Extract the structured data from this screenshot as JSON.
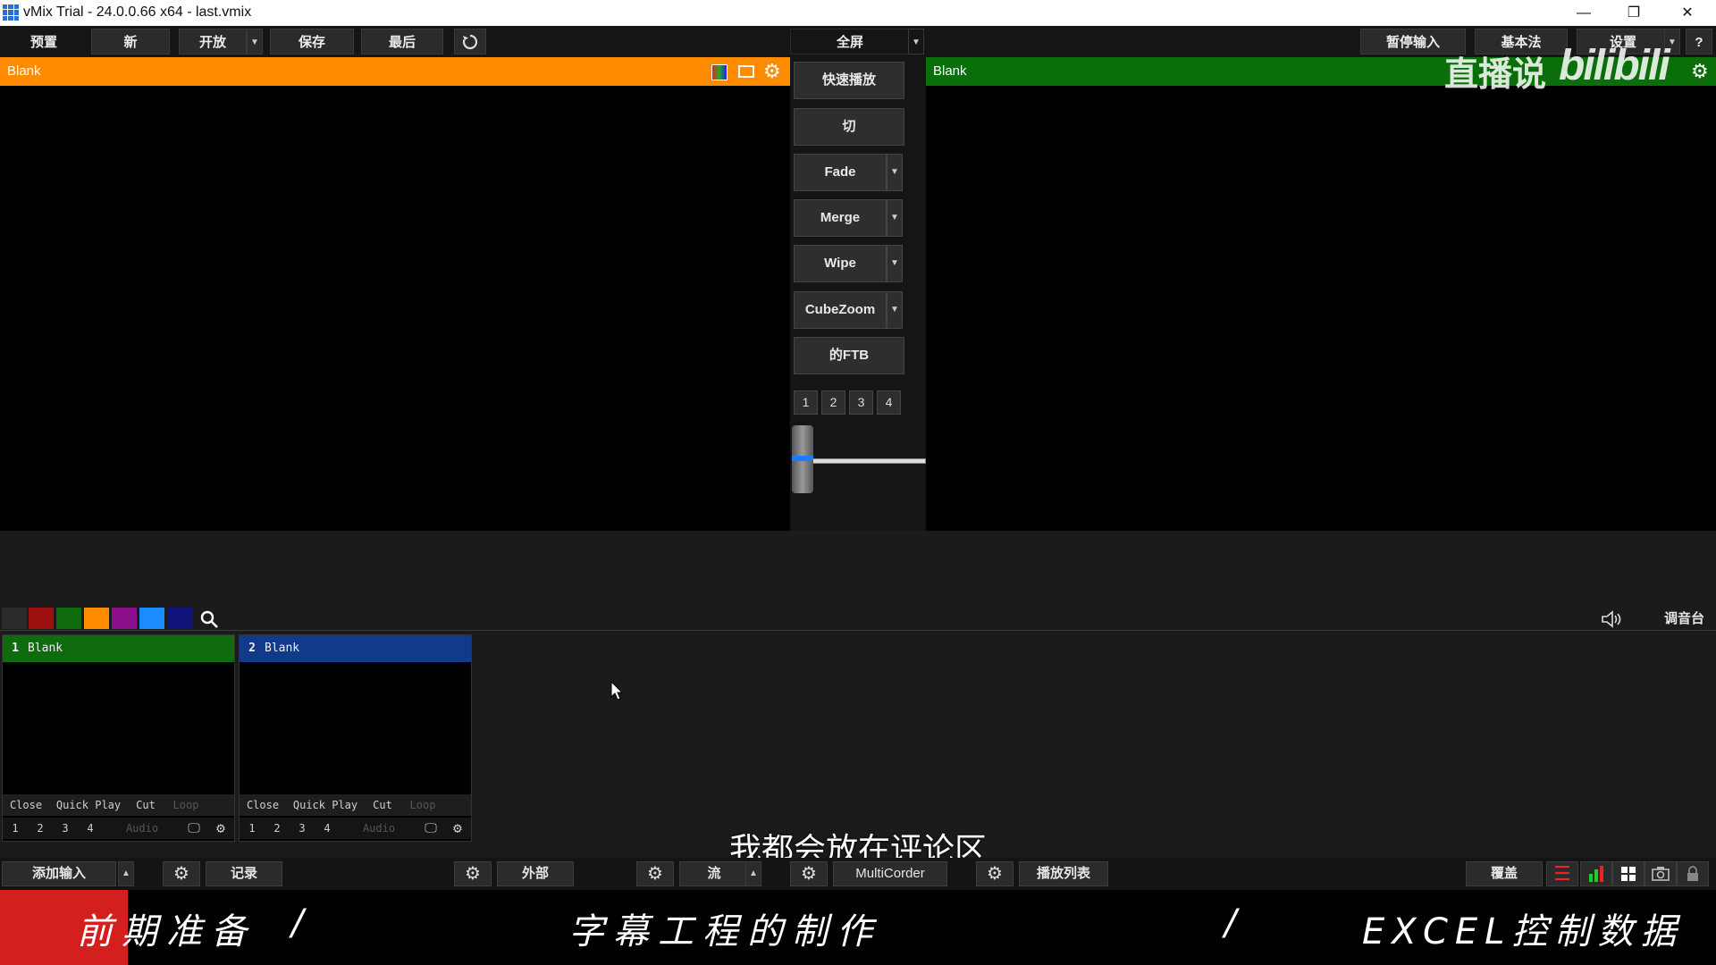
{
  "window": {
    "title": "vMix Trial - 24.0.0.66 x64 - last.vmix",
    "minimize": "—",
    "restore": "❐",
    "close": "✕"
  },
  "toolbar": {
    "preview": "预置",
    "new": "新",
    "open": "开放",
    "save": "保存",
    "last": "最后",
    "fullscreen": "全屏",
    "pause_input": "暂停输入",
    "basic": "基本法",
    "settings": "设置",
    "help": "?"
  },
  "preview_pane": {
    "title": "Blank",
    "color": "#ff8c00"
  },
  "program_pane": {
    "title": "Blank",
    "color": "#0a6e0a"
  },
  "transitions": {
    "quick_play": "快速播放",
    "cut": "切",
    "fade": "Fade",
    "merge": "Merge",
    "wipe": "Wipe",
    "cubezoom": "CubeZoom",
    "ftb": "的FTB",
    "numbers": [
      "1",
      "2",
      "3",
      "4"
    ],
    "tbar_position": 0.0
  },
  "colors": [
    "#2a2a2a",
    "#9c0f0f",
    "#0e6b0e",
    "#ff8c00",
    "#8b0f8b",
    "#1a8cff",
    "#12127a"
  ],
  "mixer": {
    "label": "调音台"
  },
  "inputs": [
    {
      "number": "1",
      "name": "Blank",
      "header_color": "#0e6b0e",
      "actions": [
        "Close",
        "Quick Play",
        "Cut",
        "Loop"
      ],
      "overlays": [
        "1",
        "2",
        "3",
        "4"
      ],
      "audio": "Audio"
    },
    {
      "number": "2",
      "name": "Blank",
      "header_color": "#123a8a",
      "actions": [
        "Close",
        "Quick Play",
        "Cut",
        "Loop"
      ],
      "overlays": [
        "1",
        "2",
        "3",
        "4"
      ],
      "audio": "Audio"
    }
  ],
  "bottom": {
    "add_input": "添加输入",
    "record": "记录",
    "external": "外部",
    "stream": "流",
    "multicorder": "MultiCorder",
    "playlist": "播放列表",
    "overlay": "覆盖"
  },
  "subtitle": "我都会放在评论区",
  "chapters": [
    "前期准备",
    "/",
    "字幕工程的制作",
    "/",
    "EXCEL控制数据"
  ],
  "watermark": {
    "text": "直播说",
    "logo": "bilibili"
  }
}
